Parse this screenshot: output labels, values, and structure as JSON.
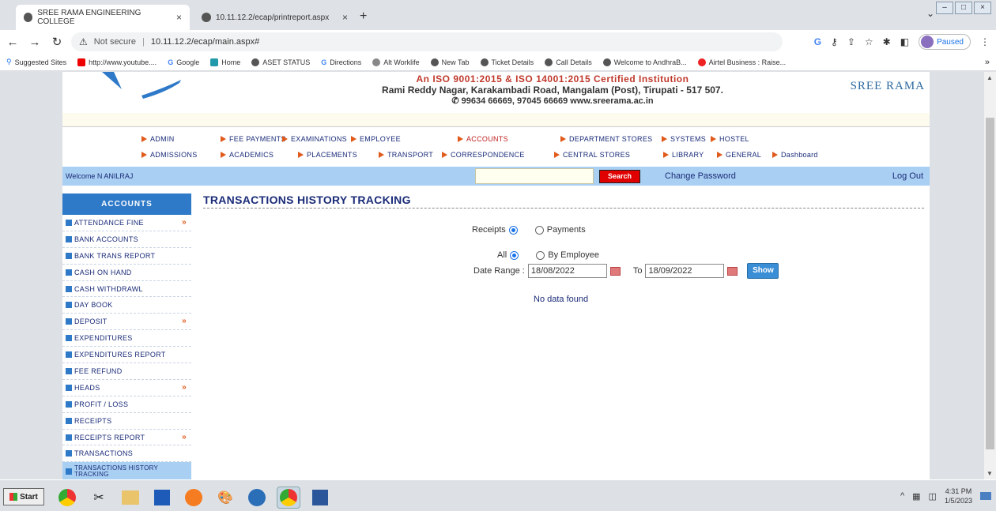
{
  "browser": {
    "tabs": [
      {
        "title": "SREE RAMA ENGINEERING COLLEGE",
        "active": true
      },
      {
        "title": "10.11.12.2/ecap/printreport.aspx",
        "active": false
      }
    ],
    "new_tab": "+",
    "tab_close": "×",
    "url": "10.11.12.2/ecap/main.aspx#",
    "not_secure": "Not secure",
    "profile_status": "Paused",
    "bookmarks": [
      "Suggested Sites",
      "http://www.youtube....",
      "Google",
      "Home",
      "ASET STATUS",
      "Directions",
      "Alt Worklife",
      "New Tab",
      "Ticket Details",
      "Call Details",
      "Welcome to AndhraB...",
      "Airtel Business : Raise..."
    ],
    "bookmarks_more": "»"
  },
  "header": {
    "iso": "An ISO 9001:2015 & ISO 14001:2015 Certified Institution",
    "address": "Rami Reddy Nagar, Karakambadi Road, Mangalam (Post), Tirupati - 517 507.",
    "contact": "99634 66669, 97045 66669   www.sreerama.ac.in",
    "brand": "SREE RAMA"
  },
  "menu": {
    "row1": [
      "ADMIN",
      "FEE PAYMENTS",
      "EXAMINATIONS",
      "EMPLOYEE",
      "ACCOUNTS",
      "DEPARTMENT STORES",
      "SYSTEMS",
      "HOSTEL"
    ],
    "row2": [
      "ADMISSIONS",
      "ACADEMICS",
      "PLACEMENTS",
      "TRANSPORT",
      "CORRESPONDENCE",
      "CENTRAL STORES",
      "LIBRARY",
      "GENERAL",
      "Dashboard"
    ]
  },
  "welcome_bar": {
    "welcome": "Welcome N ANILRAJ",
    "search_value": "",
    "search_label": "Search",
    "change_password": "Change Password",
    "logout": "Log Out"
  },
  "sidebar": {
    "title": "ACCOUNTS",
    "items": [
      {
        "label": "ATTENDANCE FINE",
        "more": "»"
      },
      {
        "label": "BANK ACCOUNTS",
        "more": ""
      },
      {
        "label": "BANK TRANS REPORT",
        "more": ""
      },
      {
        "label": "CASH ON HAND",
        "more": ""
      },
      {
        "label": "CASH WITHDRAWL",
        "more": ""
      },
      {
        "label": "DAY BOOK",
        "more": ""
      },
      {
        "label": "DEPOSIT",
        "more": "»"
      },
      {
        "label": "EXPENDITURES",
        "more": ""
      },
      {
        "label": "EXPENDITURES REPORT",
        "more": ""
      },
      {
        "label": "FEE REFUND",
        "more": ""
      },
      {
        "label": "HEADS",
        "more": "»"
      },
      {
        "label": "PROFIT / LOSS",
        "more": ""
      },
      {
        "label": "RECEIPTS",
        "more": ""
      },
      {
        "label": "RECEIPTS REPORT",
        "more": "»"
      },
      {
        "label": "TRANSACTIONS",
        "more": ""
      },
      {
        "label": "TRANSACTIONS HISTORY TRACKING",
        "more": ""
      }
    ]
  },
  "content": {
    "title": "TRANSACTIONS HISTORY TRACKING",
    "type_receipts": "Receipts",
    "type_payments": "Payments",
    "filter_all": "All",
    "filter_employee": "By Employee",
    "date_range_label": "Date Range :",
    "from_date": "18/08/2022",
    "to_label": "To",
    "to_date": "18/09/2022",
    "show_label": "Show",
    "no_data": "No data found"
  },
  "taskbar": {
    "start": "Start",
    "time": "4:31 PM",
    "date": "1/5/2023",
    "tray_arrow": "^"
  }
}
